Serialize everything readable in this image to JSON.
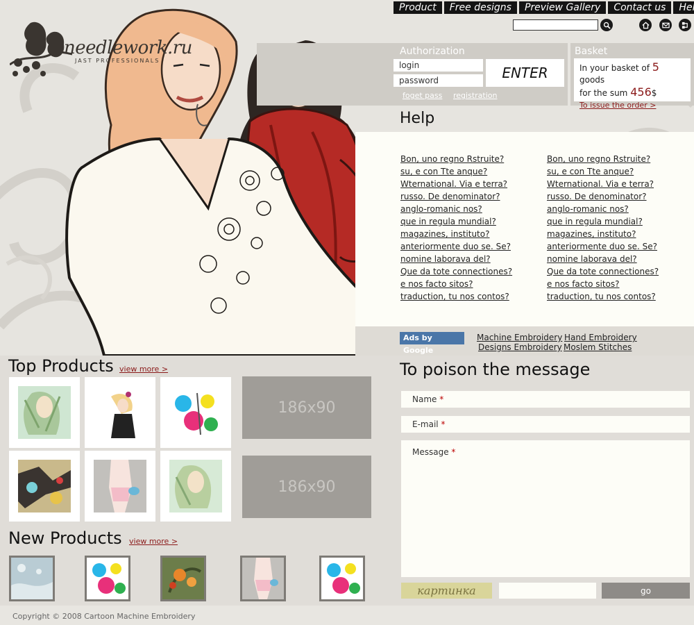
{
  "colors": {
    "accent": "#8b1a1a",
    "nav_bg": "#141414",
    "panel_bg": "#cfccc6",
    "ads_blue": "#4a76a8"
  },
  "logo": {
    "name": "needlework.ru",
    "tagline": "JAST PROFESSIONALS"
  },
  "nav": [
    "Product",
    "Free designs",
    "Preview Gallery",
    "Contact us",
    "Help"
  ],
  "search": {
    "value": ""
  },
  "icons": [
    "search-icon",
    "home-icon",
    "mail-icon",
    "sitemap-icon"
  ],
  "auth": {
    "title": "Authorization",
    "login_value": "login",
    "password_value": "password",
    "enter_label": "ENTER",
    "forgot_label": "foget pass",
    "register_label": "registration"
  },
  "basket": {
    "title": "Basket",
    "text_prefix": "In your basket of",
    "count": "5",
    "text_goods": "goods",
    "text_sum": "for the sum",
    "sum": "456",
    "currency": "$",
    "order_label": "To issue the order >"
  },
  "help": {
    "title": "Help",
    "col1": [
      "Bon, uno regno Rstruite?",
      "su, e con Tte anque?",
      "Wternational. Via e terra?",
      "russo. De denominator?",
      "anglo-romanic nos?",
      "que in regula mundial?",
      "magazines, instituto?",
      "anteriormente duo se. Se?",
      "nomine laborava del?",
      "Que da tote connectiones?",
      "e nos facto sitos?",
      "traduction, tu nos contos?"
    ],
    "col2": [
      "Bon, uno regno Rstruite?",
      "su, e con Tte anque?",
      "Wternational. Via e terra?",
      "russo. De denominator?",
      "anglo-romanic nos?",
      "que in regula mundial?",
      "magazines, instituto?",
      "anteriormente duo se. Se?",
      "nomine laborava del?",
      "Que da tote connectiones?",
      "e nos facto sitos?",
      "traduction, tu nos contos?"
    ]
  },
  "ads": {
    "badge": "Ads by Google",
    "links": [
      "Machine Embroidery",
      "Hand Embroidery",
      "Designs Embroidery",
      "Moslem Stitches"
    ]
  },
  "top_products": {
    "title": "Top Products",
    "view_more": "view more >",
    "banners": [
      "186x90",
      "186x90"
    ]
  },
  "new_products": {
    "title": "New Products",
    "view_more": "view more >"
  },
  "contact": {
    "title": "To poison the message",
    "name_label": "Name",
    "email_label": "E-mail",
    "message_label": "Message",
    "required_mark": "*",
    "captcha": "картинка",
    "submit_label": "go"
  },
  "footer": {
    "copyright": "Copyright © 2008 Cartoon Machine Embroidery"
  }
}
